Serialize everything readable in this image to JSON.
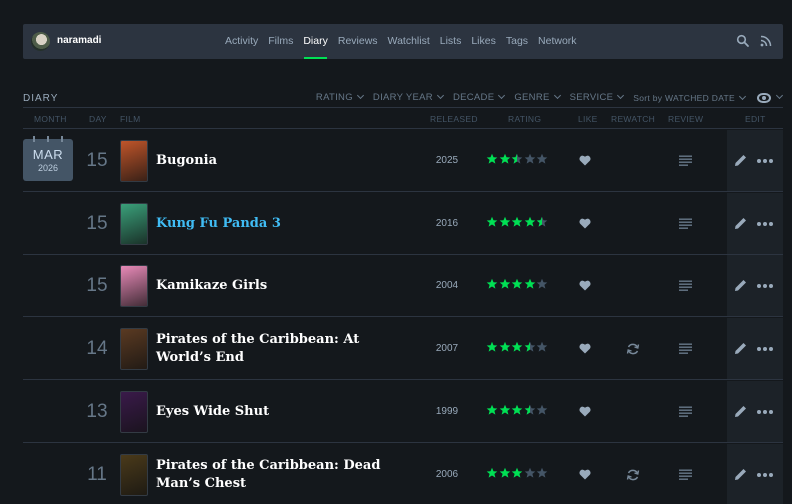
{
  "header": {
    "username": "naramadi",
    "nav": [
      "Activity",
      "Films",
      "Diary",
      "Reviews",
      "Watchlist",
      "Lists",
      "Likes",
      "Tags",
      "Network"
    ],
    "active_nav": "Diary"
  },
  "diary": {
    "title": "DIARY",
    "filters": [
      "RATING",
      "DIARY YEAR",
      "DECADE",
      "GENRE",
      "SERVICE",
      "Sort by WATCHED DATE"
    ]
  },
  "columns": {
    "month": "MONTH",
    "day": "DAY",
    "film": "FILM",
    "released": "RELEASED",
    "rating": "RATING",
    "like": "LIKE",
    "rewatch": "REWATCH",
    "review": "REVIEW",
    "edit": "EDIT"
  },
  "month_badge": {
    "month": "MAR",
    "year": "2026"
  },
  "entries": [
    {
      "day": "15",
      "film": "Bugonia",
      "released": "2025",
      "rating": 2.5,
      "liked": true,
      "rewatch": false,
      "review": true,
      "poster_color": "#c0552a",
      "linked": false
    },
    {
      "day": "15",
      "film": "Kung Fu Panda 3",
      "released": "2016",
      "rating": 4.5,
      "liked": true,
      "rewatch": false,
      "review": true,
      "poster_color": "#3aa07a",
      "linked": true
    },
    {
      "day": "15",
      "film": "Kamikaze Girls",
      "released": "2004",
      "rating": 4,
      "liked": true,
      "rewatch": false,
      "review": true,
      "poster_color": "#e88ab8",
      "linked": false
    },
    {
      "day": "14",
      "film": "Pirates of the Caribbean: At World’s End",
      "released": "2007",
      "rating": 3.5,
      "liked": true,
      "rewatch": true,
      "review": true,
      "poster_color": "#5a3a22",
      "linked": false
    },
    {
      "day": "13",
      "film": "Eyes Wide Shut",
      "released": "1999",
      "rating": 3.5,
      "liked": true,
      "rewatch": false,
      "review": true,
      "poster_color": "#3a1a4a",
      "linked": false
    },
    {
      "day": "11",
      "film": "Pirates of the Caribbean: Dead Man’s Chest",
      "released": "2006",
      "rating": 3,
      "liked": true,
      "rewatch": true,
      "review": true,
      "poster_color": "#4a3a1a",
      "linked": false
    }
  ],
  "colors": {
    "accent": "#00e054",
    "link": "#40bcf4",
    "star_empty": "#456"
  }
}
